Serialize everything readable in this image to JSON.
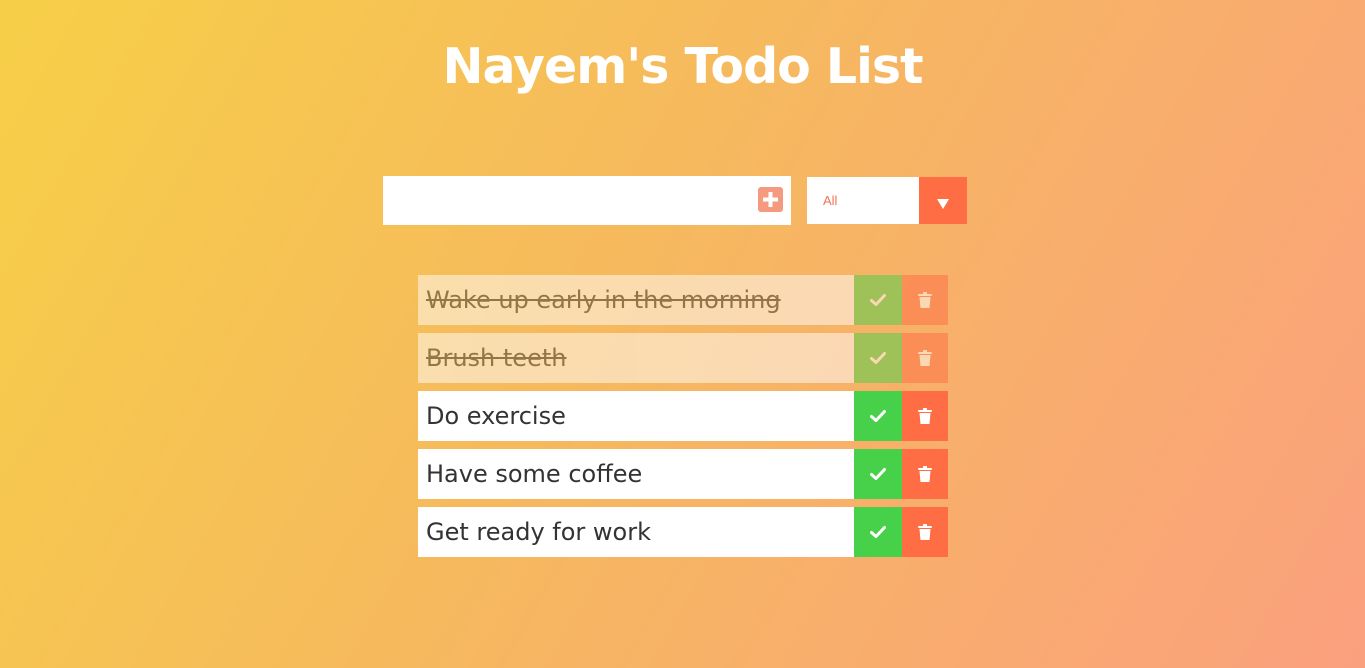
{
  "app": {
    "title": "Nayem's Todo List"
  },
  "form": {
    "input_value": "",
    "add_icon": "plus-square-icon"
  },
  "filter": {
    "selected": "All",
    "arrow_icon": "caret-down-icon"
  },
  "todos": [
    {
      "text": "Wake up early in the morning",
      "completed": true
    },
    {
      "text": "Brush teeth",
      "completed": true
    },
    {
      "text": "Do exercise",
      "completed": false
    },
    {
      "text": "Have some coffee",
      "completed": false
    },
    {
      "text": "Get ready for work",
      "completed": false
    }
  ],
  "icons": {
    "complete": "check-icon",
    "delete": "trash-icon"
  },
  "colors": {
    "complete_button": "#47d14a",
    "delete_button": "#ff6d45",
    "accent": "#f59a7e"
  }
}
